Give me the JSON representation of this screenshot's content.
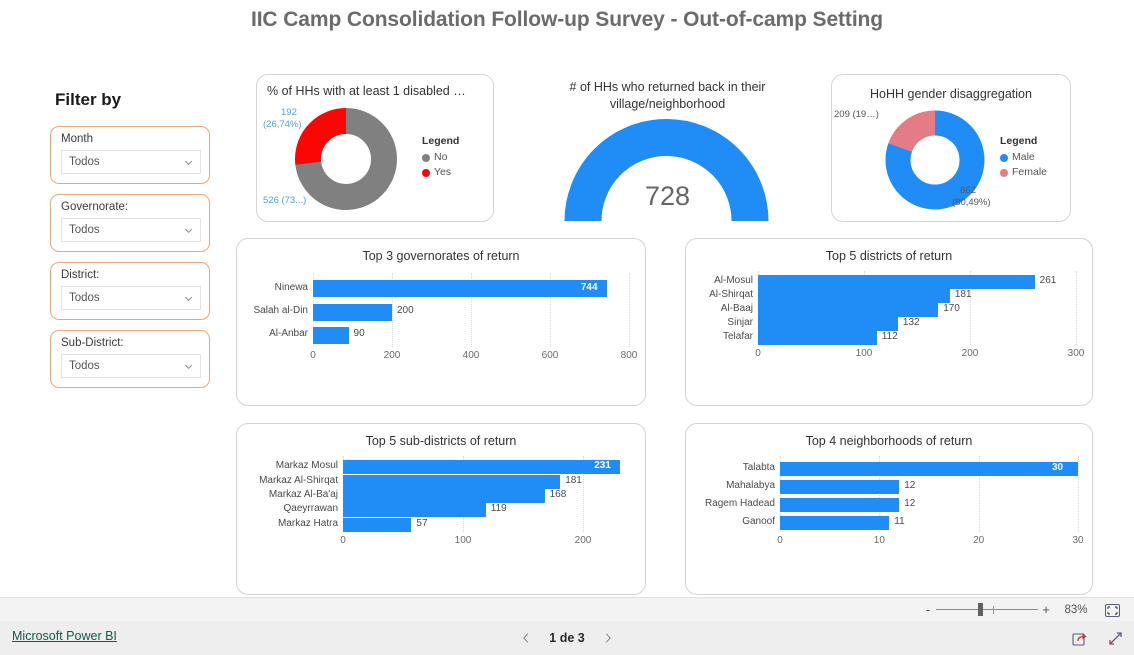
{
  "report": {
    "title": "IIC Camp Consolidation Follow-up Survey - Out-of-camp Setting"
  },
  "filter_panel": {
    "heading": "Filter by",
    "slicers": [
      {
        "label": "Month",
        "value": "Todos",
        "icon": "chevron-down-icon"
      },
      {
        "label": "Governorate:",
        "value": "Todos",
        "icon": "chevron-down-icon"
      },
      {
        "label": "District:",
        "value": "Todos",
        "icon": "chevron-down-icon"
      },
      {
        "label": "Sub-District:",
        "value": "Todos",
        "icon": "chevron-down-icon"
      }
    ]
  },
  "colors": {
    "bar_blue": "#1f8df5",
    "donut_blue": "#1f8df5",
    "donut_gray": "#808080",
    "donut_red": "#fb0505",
    "donut_pink": "#e37c84",
    "slicer_border": "#e8a87c",
    "label_blue": "#4e9fe0",
    "link_green": "#0d5c4a"
  },
  "chart_data": [
    {
      "id": "disabled-donut",
      "type": "pie",
      "title": "% of HHs with at least 1 disabled …",
      "legend_title": "Legend",
      "legend_position": "right",
      "labels": [
        "No",
        "Yes"
      ],
      "values": [
        526,
        192
      ],
      "slice_colors": [
        "#808080",
        "#fb0505"
      ],
      "data_labels": [
        "526 (73…)",
        "192\n(26,74%)"
      ],
      "label_yes_value": "192",
      "label_yes_pct": "(26,74%)",
      "label_no": "526 (73...)"
    },
    {
      "id": "returned-gauge",
      "type": "bar",
      "subtype": "gauge",
      "title": "# of HHs who returned back in their village/neighborhood",
      "value": 728,
      "value_label": "728",
      "arc_color": "#1f8df5"
    },
    {
      "id": "gender-donut",
      "type": "pie",
      "title": "HoHH gender disaggregation",
      "legend_title": "Legend",
      "legend_position": "right",
      "labels": [
        "Male",
        "Female"
      ],
      "values": [
        862,
        209
      ],
      "slice_colors": [
        "#1f8df5",
        "#e37c84"
      ],
      "label_male_value": "862",
      "label_male_pct": "(80,49%)",
      "label_female": "209 (19…)"
    },
    {
      "id": "gov-bars",
      "type": "bar",
      "orientation": "horizontal",
      "title": "Top 3 governorates of return",
      "categories": [
        "Ninewa",
        "Salah al-Din",
        "Al-Anbar"
      ],
      "values": [
        744,
        200,
        90
      ],
      "value_labels": [
        "744",
        "200",
        "90"
      ],
      "xlim": [
        0,
        800
      ],
      "xticks": [
        "0",
        "200",
        "400",
        "600",
        "800"
      ],
      "xtick_values": [
        0,
        200,
        400,
        600,
        800
      ],
      "grid": true,
      "bar_color": "#1f8df5"
    },
    {
      "id": "dist-bars",
      "type": "bar",
      "orientation": "horizontal",
      "title": "Top 5 districts of return",
      "categories": [
        "Al-Mosul",
        "Al-Shirqat",
        "Al-Baaj",
        "Sinjar",
        "Telafar"
      ],
      "values": [
        261,
        181,
        170,
        132,
        112
      ],
      "value_labels": [
        "261",
        "181",
        "170",
        "132",
        "112"
      ],
      "xlim": [
        0,
        300
      ],
      "xticks": [
        "0",
        "100",
        "200",
        "300"
      ],
      "xtick_values": [
        0,
        100,
        200,
        300
      ],
      "grid": true,
      "bar_color": "#1f8df5"
    },
    {
      "id": "sub-bars",
      "type": "bar",
      "orientation": "horizontal",
      "title": "Top 5 sub-districts of return",
      "categories": [
        "Markaz Mosul",
        "Markaz Al-Shirqat",
        "Markaz Al-Ba'aj",
        "Qaeyrrawan",
        "Markaz Hatra"
      ],
      "values": [
        231,
        181,
        168,
        119,
        57
      ],
      "value_labels": [
        "231",
        "181",
        "168",
        "119",
        "57"
      ],
      "xlim": [
        0,
        240
      ],
      "xticks": [
        "0",
        "100",
        "200"
      ],
      "xtick_values": [
        0,
        100,
        200
      ],
      "grid": true,
      "bar_color": "#1f8df5"
    },
    {
      "id": "nbhd-bars",
      "type": "bar",
      "orientation": "horizontal",
      "title": "Top 4 neighborhoods of return",
      "categories": [
        "Talabta",
        "Mahalabya",
        "Ragem Hadead",
        "Ganoof"
      ],
      "values": [
        30,
        12,
        12,
        11
      ],
      "value_labels": [
        "30",
        "12",
        "12",
        "11"
      ],
      "xlim": [
        0,
        30
      ],
      "xticks": [
        "0",
        "10",
        "20",
        "30"
      ],
      "xtick_values": [
        0,
        10,
        20,
        30
      ],
      "grid": true,
      "bar_color": "#1f8df5"
    }
  ],
  "zoom_bar": {
    "minus": "-",
    "plus": "+",
    "percent": "83%",
    "fit_icon": "fit-to-page-icon"
  },
  "footer": {
    "brand_link": "Microsoft Power BI",
    "prev_icon": "chevron-left-icon",
    "next_icon": "chevron-right-icon",
    "page_label": "1 de 3",
    "share_icon": "share-icon",
    "fullscreen_icon": "fullscreen-icon"
  }
}
